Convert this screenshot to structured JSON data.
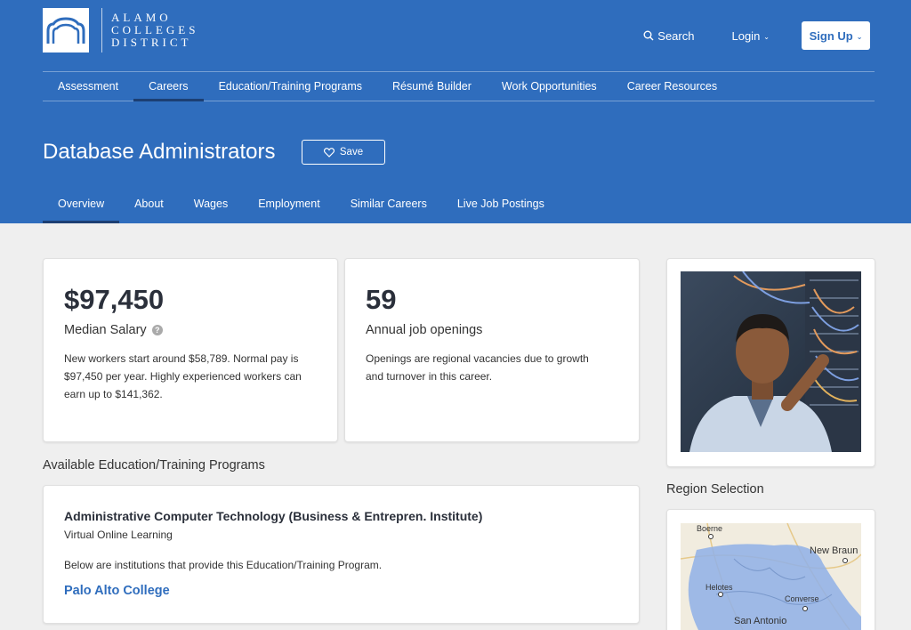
{
  "logo": {
    "lines": [
      "ALAMO",
      "COLLEGES",
      "DISTRICT"
    ],
    "icon": "alamo-arch-logo-icon"
  },
  "top_actions": {
    "search": "Search",
    "login": "Login",
    "signup": "Sign Up"
  },
  "nav": [
    "Assessment",
    "Careers",
    "Education/Training Programs",
    "Résumé Builder",
    "Work Opportunities",
    "Career Resources"
  ],
  "nav_active": "Careers",
  "page": {
    "title": "Database Administrators",
    "save_label": "Save"
  },
  "tabs": [
    "Overview",
    "About",
    "Wages",
    "Employment",
    "Similar Careers",
    "Live Job Postings"
  ],
  "tab_active": "Overview",
  "salary": {
    "value": "$97,450",
    "label": "Median Salary",
    "description": "New workers start around $58,789. Normal pay is $97,450 per year. Highly experienced workers can earn up to $141,362."
  },
  "openings": {
    "value": "59",
    "label": "Annual job openings",
    "description": "Openings are regional vacancies due to growth and turnover in this career."
  },
  "programs": {
    "heading": "Available Education/Training Programs",
    "title": "Administrative Computer Technology (Business & Entrepren. Institute)",
    "subtitle": "Virtual Online Learning",
    "note": "Below are institutions that provide this Education/Training Program.",
    "institution": "Palo Alto College"
  },
  "region": {
    "heading": "Region Selection",
    "cities": [
      "Boerne",
      "New Braun",
      "Helotes",
      "Converse",
      "San Antonio"
    ]
  },
  "colors": {
    "brand": "#2f6dbd",
    "underline": "#1c3f73",
    "page_bg": "#efefef"
  }
}
